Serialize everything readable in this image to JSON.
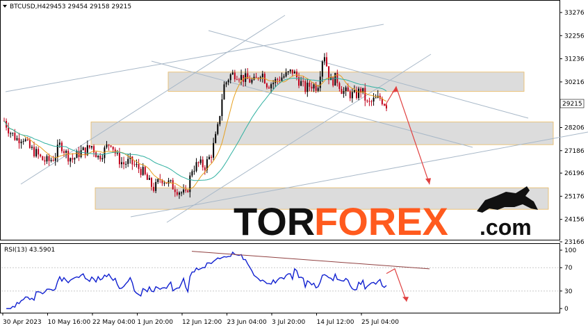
{
  "header": {
    "symbol_info": "BTCUSD,H4",
    "ohlc": "29453 29454 29158 29215"
  },
  "rsi_label": "RSI(13) 43.5901",
  "price_label": "29215",
  "logo": {
    "part1": "TOR",
    "part2": "FOREX",
    "part3": ".com"
  },
  "colors": {
    "bull": "#000000",
    "bear": "#c0001a",
    "ma_fast": "#e6a020",
    "ma_slow": "#2fb0a0",
    "rsi": "#1020d0",
    "zone_fill": "#dcdcdc",
    "zone_border": "#e8b860",
    "trend": "#a8b8c8",
    "forecast": "#e04040",
    "logo_dark": "#111111",
    "logo_orange": "#ff5a1e"
  },
  "chart_data": {
    "type": "candlestick",
    "price_axis": {
      "ticks": [
        "33276",
        "32256",
        "31236",
        "30216",
        "29215",
        "28206",
        "27186",
        "26196",
        "25176",
        "24156",
        "23166"
      ],
      "range": [
        23166,
        33276
      ]
    },
    "rsi_axis": {
      "ticks": [
        "100",
        "70",
        "30",
        "0"
      ],
      "range": [
        0,
        100
      ]
    },
    "time_axis": [
      "30 Apr 2023",
      "10 May 16:00",
      "22 May 04:00",
      "1 Jun 20:00",
      "12 Jun 12:00",
      "23 Jun 04:00",
      "3 Jul 20:00",
      "14 Jul 12:00",
      "25 Jul 04:00"
    ],
    "last_price": 29215,
    "rsi_last": 43.5901,
    "zones": [
      {
        "low": 29800,
        "high": 30650
      },
      {
        "low": 27450,
        "high": 28450
      },
      {
        "low": 24600,
        "high": 25550
      }
    ],
    "series_points": [
      28500,
      28000,
      27700,
      27800,
      27300,
      27100,
      26800,
      26700,
      26900,
      27500,
      27000,
      26800,
      27100,
      27200,
      27400,
      26900,
      27200,
      27600,
      26900,
      26600,
      26700,
      26500,
      26300,
      25800,
      25500,
      26000,
      25800,
      25600,
      25400,
      25200,
      26400,
      26600,
      26500,
      27000,
      28000,
      30000,
      30500,
      30600,
      30400,
      30300,
      30200,
      30700,
      30100,
      30200,
      30400,
      30500,
      30700,
      30300,
      29900,
      30100,
      30000,
      31600,
      30200,
      30400,
      29800,
      29700,
      29600,
      29900,
      29200,
      29400,
      29500,
      29215
    ],
    "forecast_price": [
      30000,
      25700
    ]
  }
}
